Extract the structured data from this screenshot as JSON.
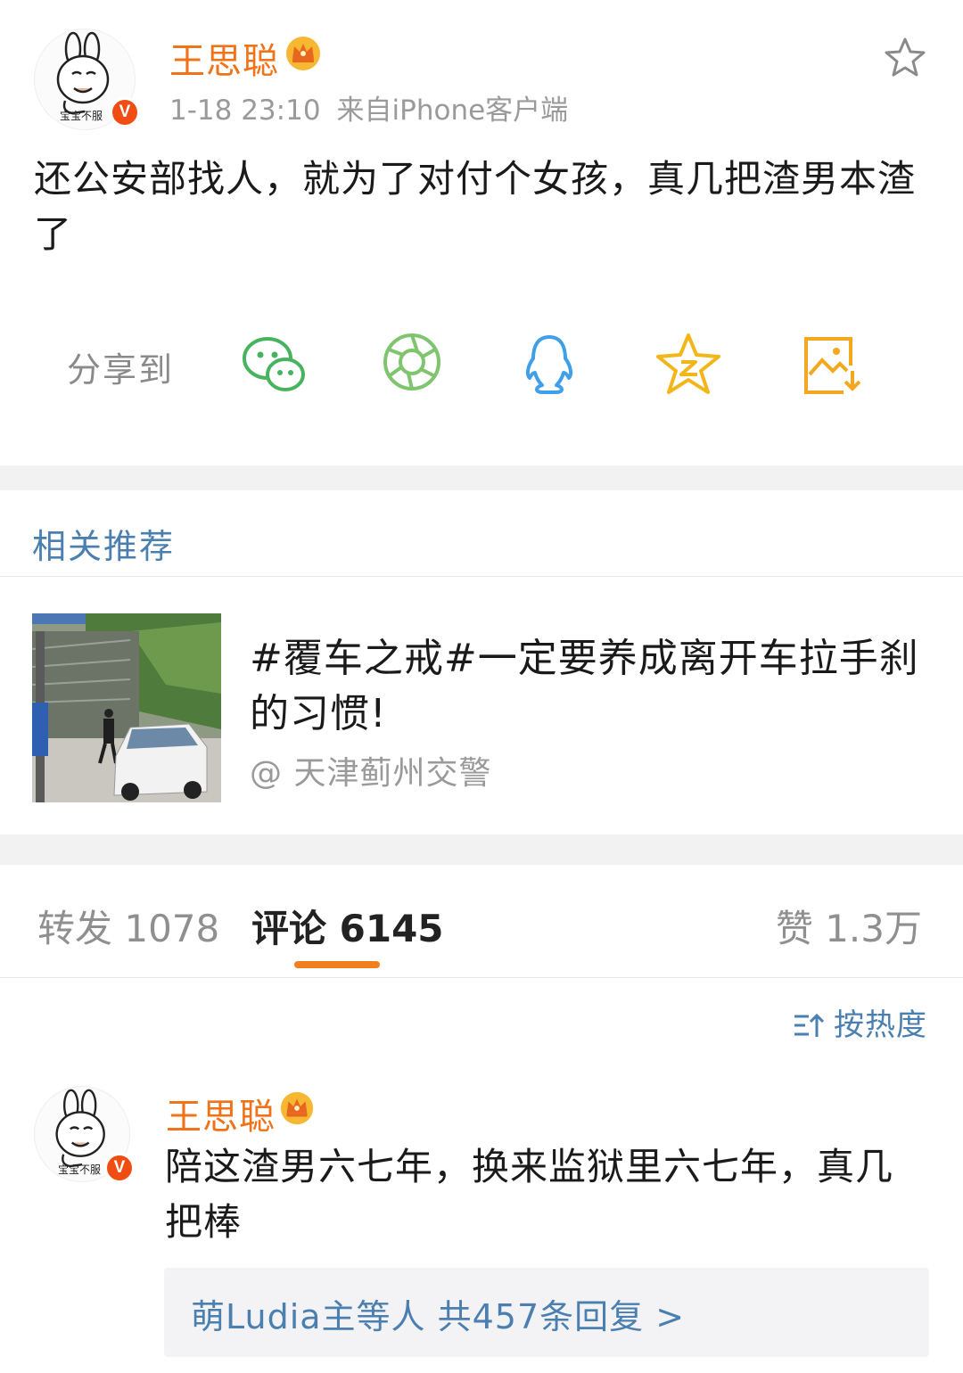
{
  "post": {
    "author": "王思聪",
    "avatar_caption": "宝宝不服",
    "verified_badge": "V",
    "time": "1-18 23:10",
    "source": "来自iPhone客户端",
    "text": "还公安部找人，就为了对付个女孩，真几把渣男本渣了"
  },
  "share": {
    "label": "分享到",
    "icons": [
      "wechat-icon",
      "moments-icon",
      "qq-icon",
      "qzone-icon",
      "save-image-icon"
    ]
  },
  "recommend": {
    "title": "相关推荐",
    "item_text": "#覆车之戒#一定要养成离开车拉手刹的习惯!",
    "item_source": "@ 天津蓟州交警"
  },
  "tabs": {
    "repost": "转发 1078",
    "comment": "评论 6145",
    "like": "赞 1.3万"
  },
  "sort_label": "按热度",
  "comment": {
    "author": "王思聪",
    "avatar_caption": "宝宝不服",
    "verified_badge": "V",
    "text": "陪这渣男六七年，换来监狱里六七年，真几把棒",
    "replies": "萌Ludia主等人  共457条回复 >"
  },
  "colors": {
    "username": "#f0731a",
    "link": "#4a7fb0",
    "accent_underline": "#f07f1e",
    "separator": "#f2f2f2"
  }
}
